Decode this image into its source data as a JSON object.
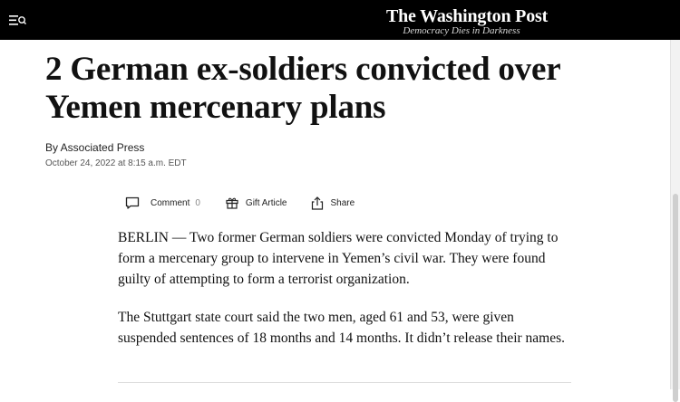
{
  "header": {
    "logo": "The Washington Post",
    "tagline": "Democracy Dies in Darkness",
    "menu_icon": "menu-icon"
  },
  "article": {
    "headline": "2 German ex-soldiers convicted over Yemen mercenary plans",
    "byline": "By Associated Press",
    "date": "October 24, 2022 at 8:15 a.m. EDT",
    "paragraphs": [
      "BERLIN — Two former German soldiers were convicted Monday of trying to form a mercenary group to intervene in Yemen’s civil war. They were found guilty of attempting to form a terrorist organization.",
      "The Stuttgart state court said the two men, aged 61 and 53, were given suspended sentences of 18 months and 14 months. It didn’t release their names."
    ]
  },
  "actions": {
    "comment_label": "Comment",
    "comment_count": "0",
    "gift_label": "Gift Article",
    "share_label": "Share",
    "icons": [
      "comment-icon",
      "gift-icon",
      "share-icon"
    ]
  },
  "colors": {
    "topbar": "#000000",
    "text": "#111111"
  }
}
